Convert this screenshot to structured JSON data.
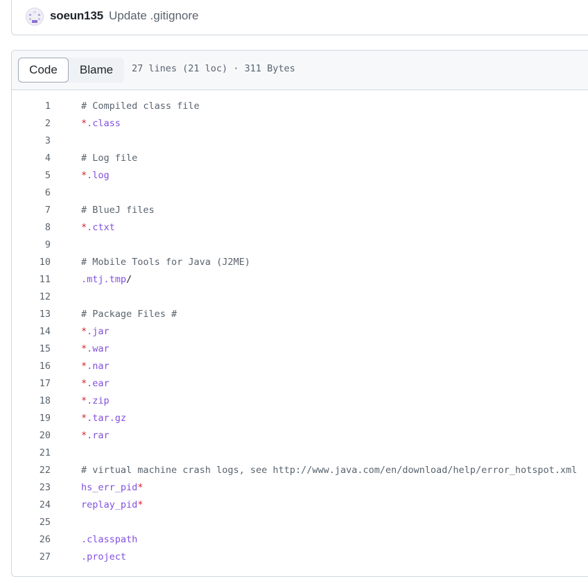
{
  "commit": {
    "author": "soeun135",
    "message": "Update .gitignore",
    "avatar_icon": "identicon-avatar"
  },
  "file_header": {
    "tabs": [
      {
        "label": "Code",
        "active": true
      },
      {
        "label": "Blame",
        "active": false
      }
    ],
    "meta": "27 lines (21 loc) · 311 Bytes"
  },
  "colors": {
    "comment": "#59636e",
    "wildcard": "#cf222e",
    "pattern": "#8250df",
    "border": "#d0d7de",
    "header_bg": "#f6f8fa"
  },
  "code_lines": [
    {
      "num": "1",
      "tokens": [
        {
          "type": "comment",
          "text": "# Compiled class file"
        }
      ]
    },
    {
      "num": "2",
      "tokens": [
        {
          "type": "star",
          "text": "*"
        },
        {
          "type": "pattern",
          "text": ".class"
        }
      ]
    },
    {
      "num": "3",
      "tokens": []
    },
    {
      "num": "4",
      "tokens": [
        {
          "type": "comment",
          "text": "# Log file"
        }
      ]
    },
    {
      "num": "5",
      "tokens": [
        {
          "type": "star",
          "text": "*"
        },
        {
          "type": "pattern",
          "text": ".log"
        }
      ]
    },
    {
      "num": "6",
      "tokens": []
    },
    {
      "num": "7",
      "tokens": [
        {
          "type": "comment",
          "text": "# BlueJ files"
        }
      ]
    },
    {
      "num": "8",
      "tokens": [
        {
          "type": "star",
          "text": "*"
        },
        {
          "type": "pattern",
          "text": ".ctxt"
        }
      ]
    },
    {
      "num": "9",
      "tokens": []
    },
    {
      "num": "10",
      "tokens": [
        {
          "type": "comment",
          "text": "# Mobile Tools for Java (J2ME)"
        }
      ]
    },
    {
      "num": "11",
      "tokens": [
        {
          "type": "pattern",
          "text": ".mtj.tmp"
        },
        {
          "type": "plain",
          "text": "/"
        }
      ]
    },
    {
      "num": "12",
      "tokens": []
    },
    {
      "num": "13",
      "tokens": [
        {
          "type": "comment",
          "text": "# Package Files #"
        }
      ]
    },
    {
      "num": "14",
      "tokens": [
        {
          "type": "star",
          "text": "*"
        },
        {
          "type": "pattern",
          "text": ".jar"
        }
      ]
    },
    {
      "num": "15",
      "tokens": [
        {
          "type": "star",
          "text": "*"
        },
        {
          "type": "pattern",
          "text": ".war"
        }
      ]
    },
    {
      "num": "16",
      "tokens": [
        {
          "type": "star",
          "text": "*"
        },
        {
          "type": "pattern",
          "text": ".nar"
        }
      ]
    },
    {
      "num": "17",
      "tokens": [
        {
          "type": "star",
          "text": "*"
        },
        {
          "type": "pattern",
          "text": ".ear"
        }
      ]
    },
    {
      "num": "18",
      "tokens": [
        {
          "type": "star",
          "text": "*"
        },
        {
          "type": "pattern",
          "text": ".zip"
        }
      ]
    },
    {
      "num": "19",
      "tokens": [
        {
          "type": "star",
          "text": "*"
        },
        {
          "type": "pattern",
          "text": ".tar.gz"
        }
      ]
    },
    {
      "num": "20",
      "tokens": [
        {
          "type": "star",
          "text": "*"
        },
        {
          "type": "pattern",
          "text": ".rar"
        }
      ]
    },
    {
      "num": "21",
      "tokens": []
    },
    {
      "num": "22",
      "tokens": [
        {
          "type": "comment",
          "text": "# virtual machine crash logs, see http://www.java.com/en/download/help/error_hotspot.xml"
        }
      ]
    },
    {
      "num": "23",
      "tokens": [
        {
          "type": "pattern",
          "text": "hs_err_pid"
        },
        {
          "type": "star",
          "text": "*"
        }
      ]
    },
    {
      "num": "24",
      "tokens": [
        {
          "type": "pattern",
          "text": "replay_pid"
        },
        {
          "type": "star",
          "text": "*"
        }
      ]
    },
    {
      "num": "25",
      "tokens": []
    },
    {
      "num": "26",
      "tokens": [
        {
          "type": "pattern",
          "text": ".classpath"
        }
      ]
    },
    {
      "num": "27",
      "tokens": [
        {
          "type": "pattern",
          "text": ".project"
        }
      ]
    }
  ]
}
